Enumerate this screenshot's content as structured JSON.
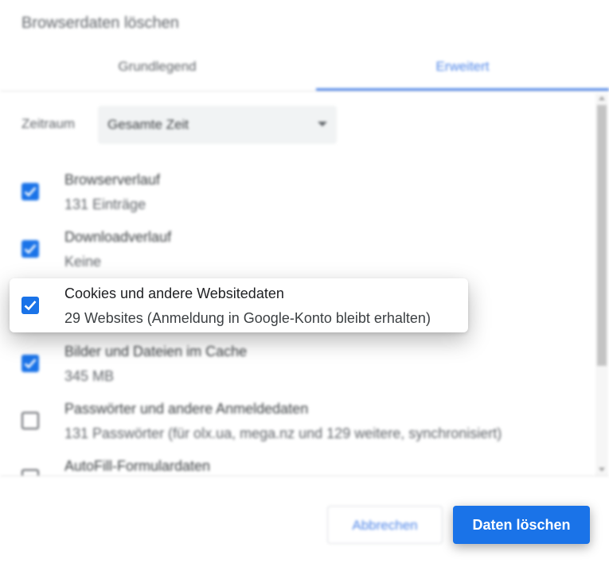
{
  "dialog": {
    "title": "Browserdaten löschen"
  },
  "tabs": [
    {
      "label": "Grundlegend",
      "active": false
    },
    {
      "label": "Erweitert",
      "active": true
    }
  ],
  "time_range": {
    "label": "Zeitraum",
    "selected": "Gesamte Zeit"
  },
  "items": [
    {
      "title": "Browserverlauf",
      "subtitle": "131 Einträge",
      "checked": true
    },
    {
      "title": "Downloadverlauf",
      "subtitle": "Keine",
      "checked": true
    },
    {
      "title": "Cookies und andere Websitedaten",
      "subtitle": "29 Websites (Anmeldung in Google-Konto bleibt erhalten)",
      "checked": true
    },
    {
      "title": "Bilder und Dateien im Cache",
      "subtitle": "345 MB",
      "checked": true
    },
    {
      "title": "Passwörter und andere Anmeldedaten",
      "subtitle": "131 Passwörter (für olx.ua, mega.nz und 129 weitere, synchronisiert)",
      "checked": false
    },
    {
      "title": "AutoFill-Formulardaten",
      "subtitle": "",
      "checked": false
    }
  ],
  "buttons": {
    "cancel": "Abbrechen",
    "delete": "Daten löschen"
  },
  "colors": {
    "accent": "#1a73e8",
    "tab_active": "#4f86e8",
    "text_primary": "#3c4043",
    "text_secondary": "#5f6368"
  }
}
